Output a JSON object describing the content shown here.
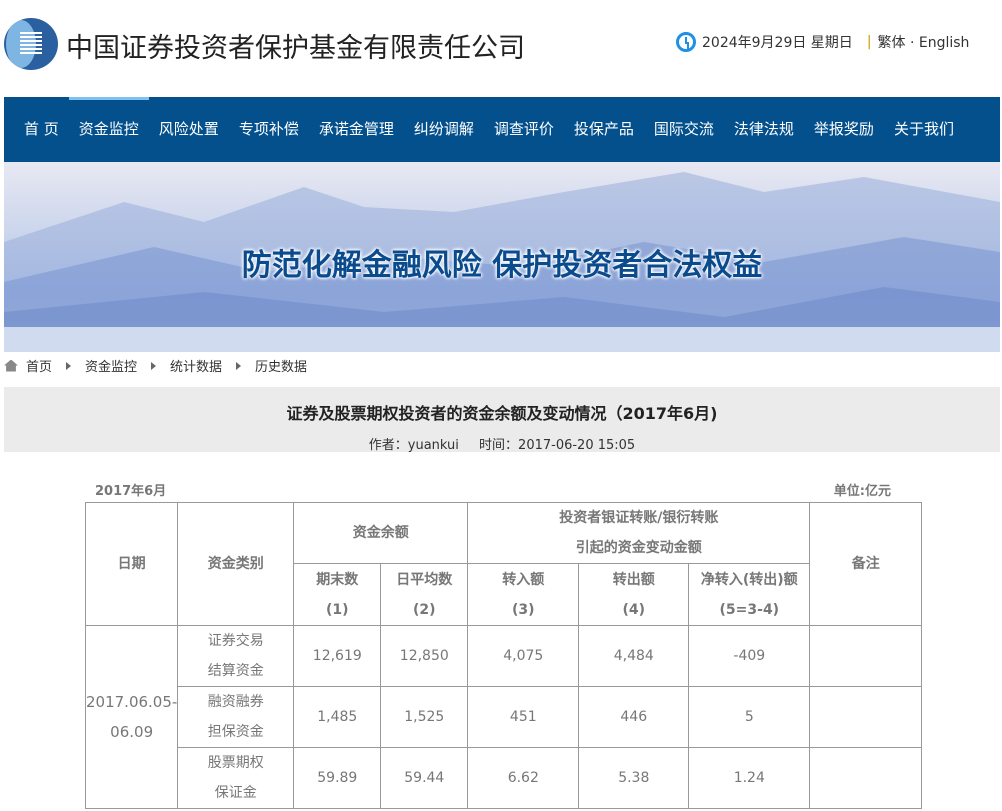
{
  "header": {
    "site_title": "中国证券投资者保护基金有限责任公司",
    "date": "2024年9月29日 星期日",
    "lang_links": "繁体 · English"
  },
  "nav": [
    "首 页",
    "资金监控",
    "风险处置",
    "专项补偿",
    "承诺金管理",
    "纠纷调解",
    "调查评价",
    "投保产品",
    "国际交流",
    "法律法规",
    "举报奖励",
    "关于我们"
  ],
  "banner": {
    "slogan": "防范化解金融风险 保护投资者合法权益"
  },
  "breadcrumb": [
    "首页",
    "资金监控",
    "统计数据",
    "历史数据"
  ],
  "article": {
    "title": "证券及股票期权投资者的资金余额及变动情况（2017年6月)",
    "author": "作者：yuankui",
    "time": "时间：2017-06-20 15:05"
  },
  "table": {
    "caption_left": "2017年6月",
    "caption_right": "单位:亿元",
    "headers": {
      "date": "日期",
      "type": "资金类别",
      "balance": "资金余额",
      "transfer_l1": "投资者银证转账/银衍转账",
      "transfer_l2": "引起的资金变动金额",
      "note": "备注",
      "sub": [
        [
          "期末数",
          "(1)"
        ],
        [
          "日平均数",
          "(2)"
        ],
        [
          "转入额",
          "(3)"
        ],
        [
          "转出额",
          "(4)"
        ],
        [
          "净转入(转出)额",
          "(5=3-4)"
        ]
      ]
    },
    "period": [
      "2017.06.05-",
      "06.09"
    ],
    "rows": [
      {
        "type": [
          "证券交易",
          "结算资金"
        ],
        "values": [
          "12,619",
          "12,850",
          "4,075",
          "4,484",
          "-409"
        ]
      },
      {
        "type": [
          "融资融券",
          "担保资金"
        ],
        "values": [
          "1,485",
          "1,525",
          "451",
          "446",
          "5"
        ]
      },
      {
        "type": [
          "股票期权",
          "保证金"
        ],
        "values": [
          "59.89",
          "59.44",
          "6.62",
          "5.38",
          "1.24"
        ]
      }
    ]
  }
}
